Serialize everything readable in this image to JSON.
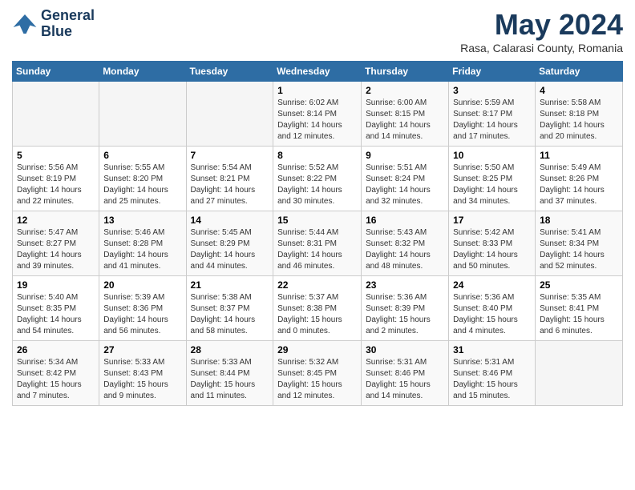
{
  "header": {
    "logo_line1": "General",
    "logo_line2": "Blue",
    "month": "May 2024",
    "location": "Rasa, Calarasi County, Romania"
  },
  "days_of_week": [
    "Sunday",
    "Monday",
    "Tuesday",
    "Wednesday",
    "Thursday",
    "Friday",
    "Saturday"
  ],
  "weeks": [
    [
      {
        "day": "",
        "sunrise": "",
        "sunset": "",
        "daylight": ""
      },
      {
        "day": "",
        "sunrise": "",
        "sunset": "",
        "daylight": ""
      },
      {
        "day": "",
        "sunrise": "",
        "sunset": "",
        "daylight": ""
      },
      {
        "day": "1",
        "sunrise": "Sunrise: 6:02 AM",
        "sunset": "Sunset: 8:14 PM",
        "daylight": "Daylight: 14 hours and 12 minutes."
      },
      {
        "day": "2",
        "sunrise": "Sunrise: 6:00 AM",
        "sunset": "Sunset: 8:15 PM",
        "daylight": "Daylight: 14 hours and 14 minutes."
      },
      {
        "day": "3",
        "sunrise": "Sunrise: 5:59 AM",
        "sunset": "Sunset: 8:17 PM",
        "daylight": "Daylight: 14 hours and 17 minutes."
      },
      {
        "day": "4",
        "sunrise": "Sunrise: 5:58 AM",
        "sunset": "Sunset: 8:18 PM",
        "daylight": "Daylight: 14 hours and 20 minutes."
      }
    ],
    [
      {
        "day": "5",
        "sunrise": "Sunrise: 5:56 AM",
        "sunset": "Sunset: 8:19 PM",
        "daylight": "Daylight: 14 hours and 22 minutes."
      },
      {
        "day": "6",
        "sunrise": "Sunrise: 5:55 AM",
        "sunset": "Sunset: 8:20 PM",
        "daylight": "Daylight: 14 hours and 25 minutes."
      },
      {
        "day": "7",
        "sunrise": "Sunrise: 5:54 AM",
        "sunset": "Sunset: 8:21 PM",
        "daylight": "Daylight: 14 hours and 27 minutes."
      },
      {
        "day": "8",
        "sunrise": "Sunrise: 5:52 AM",
        "sunset": "Sunset: 8:22 PM",
        "daylight": "Daylight: 14 hours and 30 minutes."
      },
      {
        "day": "9",
        "sunrise": "Sunrise: 5:51 AM",
        "sunset": "Sunset: 8:24 PM",
        "daylight": "Daylight: 14 hours and 32 minutes."
      },
      {
        "day": "10",
        "sunrise": "Sunrise: 5:50 AM",
        "sunset": "Sunset: 8:25 PM",
        "daylight": "Daylight: 14 hours and 34 minutes."
      },
      {
        "day": "11",
        "sunrise": "Sunrise: 5:49 AM",
        "sunset": "Sunset: 8:26 PM",
        "daylight": "Daylight: 14 hours and 37 minutes."
      }
    ],
    [
      {
        "day": "12",
        "sunrise": "Sunrise: 5:47 AM",
        "sunset": "Sunset: 8:27 PM",
        "daylight": "Daylight: 14 hours and 39 minutes."
      },
      {
        "day": "13",
        "sunrise": "Sunrise: 5:46 AM",
        "sunset": "Sunset: 8:28 PM",
        "daylight": "Daylight: 14 hours and 41 minutes."
      },
      {
        "day": "14",
        "sunrise": "Sunrise: 5:45 AM",
        "sunset": "Sunset: 8:29 PM",
        "daylight": "Daylight: 14 hours and 44 minutes."
      },
      {
        "day": "15",
        "sunrise": "Sunrise: 5:44 AM",
        "sunset": "Sunset: 8:31 PM",
        "daylight": "Daylight: 14 hours and 46 minutes."
      },
      {
        "day": "16",
        "sunrise": "Sunrise: 5:43 AM",
        "sunset": "Sunset: 8:32 PM",
        "daylight": "Daylight: 14 hours and 48 minutes."
      },
      {
        "day": "17",
        "sunrise": "Sunrise: 5:42 AM",
        "sunset": "Sunset: 8:33 PM",
        "daylight": "Daylight: 14 hours and 50 minutes."
      },
      {
        "day": "18",
        "sunrise": "Sunrise: 5:41 AM",
        "sunset": "Sunset: 8:34 PM",
        "daylight": "Daylight: 14 hours and 52 minutes."
      }
    ],
    [
      {
        "day": "19",
        "sunrise": "Sunrise: 5:40 AM",
        "sunset": "Sunset: 8:35 PM",
        "daylight": "Daylight: 14 hours and 54 minutes."
      },
      {
        "day": "20",
        "sunrise": "Sunrise: 5:39 AM",
        "sunset": "Sunset: 8:36 PM",
        "daylight": "Daylight: 14 hours and 56 minutes."
      },
      {
        "day": "21",
        "sunrise": "Sunrise: 5:38 AM",
        "sunset": "Sunset: 8:37 PM",
        "daylight": "Daylight: 14 hours and 58 minutes."
      },
      {
        "day": "22",
        "sunrise": "Sunrise: 5:37 AM",
        "sunset": "Sunset: 8:38 PM",
        "daylight": "Daylight: 15 hours and 0 minutes."
      },
      {
        "day": "23",
        "sunrise": "Sunrise: 5:36 AM",
        "sunset": "Sunset: 8:39 PM",
        "daylight": "Daylight: 15 hours and 2 minutes."
      },
      {
        "day": "24",
        "sunrise": "Sunrise: 5:36 AM",
        "sunset": "Sunset: 8:40 PM",
        "daylight": "Daylight: 15 hours and 4 minutes."
      },
      {
        "day": "25",
        "sunrise": "Sunrise: 5:35 AM",
        "sunset": "Sunset: 8:41 PM",
        "daylight": "Daylight: 15 hours and 6 minutes."
      }
    ],
    [
      {
        "day": "26",
        "sunrise": "Sunrise: 5:34 AM",
        "sunset": "Sunset: 8:42 PM",
        "daylight": "Daylight: 15 hours and 7 minutes."
      },
      {
        "day": "27",
        "sunrise": "Sunrise: 5:33 AM",
        "sunset": "Sunset: 8:43 PM",
        "daylight": "Daylight: 15 hours and 9 minutes."
      },
      {
        "day": "28",
        "sunrise": "Sunrise: 5:33 AM",
        "sunset": "Sunset: 8:44 PM",
        "daylight": "Daylight: 15 hours and 11 minutes."
      },
      {
        "day": "29",
        "sunrise": "Sunrise: 5:32 AM",
        "sunset": "Sunset: 8:45 PM",
        "daylight": "Daylight: 15 hours and 12 minutes."
      },
      {
        "day": "30",
        "sunrise": "Sunrise: 5:31 AM",
        "sunset": "Sunset: 8:46 PM",
        "daylight": "Daylight: 15 hours and 14 minutes."
      },
      {
        "day": "31",
        "sunrise": "Sunrise: 5:31 AM",
        "sunset": "Sunset: 8:46 PM",
        "daylight": "Daylight: 15 hours and 15 minutes."
      },
      {
        "day": "",
        "sunrise": "",
        "sunset": "",
        "daylight": ""
      }
    ]
  ]
}
